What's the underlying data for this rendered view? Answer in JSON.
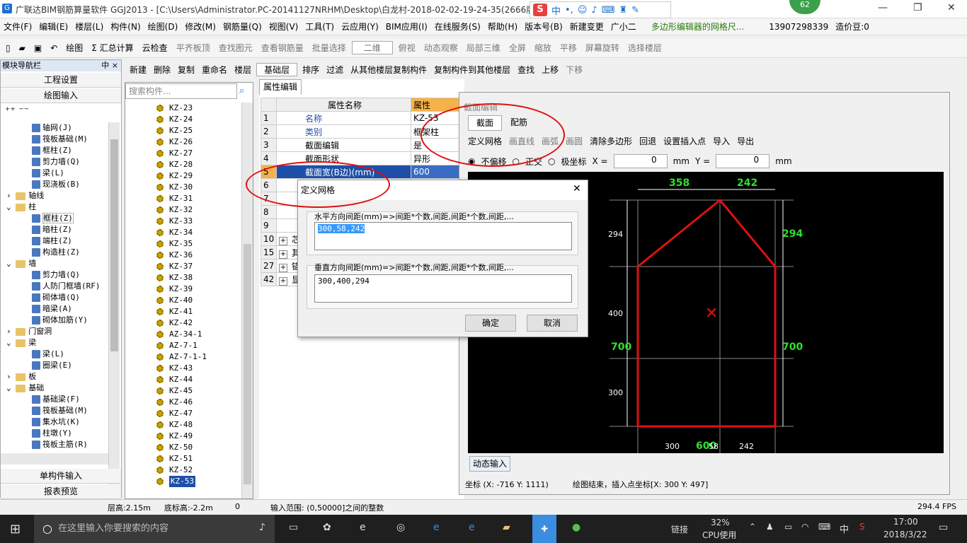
{
  "window": {
    "title": "广联达BIM钢筋算量软件 GGJ2013 - [C:\\Users\\Administrator.PC-20141127NRHM\\Desktop\\白龙村-2018-02-02-19-24-35(2666版",
    "badge": "62"
  },
  "ime": {
    "s": "S",
    "mode": "中"
  },
  "menu": [
    "文件(F)",
    "编辑(E)",
    "楼层(L)",
    "构件(N)",
    "绘图(D)",
    "修改(M)",
    "钢筋量(Q)",
    "视图(V)",
    "工具(T)",
    "云应用(Y)",
    "BIM应用(I)",
    "在线服务(S)",
    "帮助(H)",
    "版本号(B)",
    "新建变更",
    "广小二",
    "多边形编辑器的网格尺...",
    "13907298339",
    "造价豆:0"
  ],
  "toolbar": {
    "draw": "绘图",
    "sum": "Σ 汇总计算",
    "cloud": "云检查",
    "flat": "平齐板顶",
    "find": "查找图元",
    "view_rebar": "查看钢筋量",
    "batch": "批量选择",
    "view2d": "二维",
    "top": "俯视",
    "dyn": "动态观察",
    "local3d": "局部三维",
    "full": "全屏",
    "zoom": "缩放",
    "pan": "平移",
    "rotate": "屏幕旋转",
    "selfloor": "选择楼层"
  },
  "toolbar2": {
    "new": "新建",
    "delete": "删除",
    "copy": "复制",
    "rename": "重命名",
    "floor_label": "楼层",
    "floor": "基础层",
    "sort": "排序",
    "filter": "过滤",
    "copy_from": "从其他楼层复制构件",
    "copy_to": "复制构件到其他楼层",
    "find": "查找",
    "up": "上移",
    "down": "下移"
  },
  "nav": {
    "header": "模块导航栏",
    "pin": "中 ×",
    "btn1": "工程设置",
    "btn2": "绘图输入",
    "btn3": "单构件输入",
    "btn4": "报表预览"
  },
  "tree": [
    {
      "t": "轴网(J)",
      "l": 2,
      "k": "i"
    },
    {
      "t": "筏板基础(M)",
      "l": 2,
      "k": "i"
    },
    {
      "t": "框柱(Z)",
      "l": 2,
      "k": "i"
    },
    {
      "t": "剪力墙(Q)",
      "l": 2,
      "k": "i"
    },
    {
      "t": "梁(L)",
      "l": 2,
      "k": "i"
    },
    {
      "t": "现浇板(B)",
      "l": 2,
      "k": "i"
    },
    {
      "t": "轴线",
      "l": 1,
      "k": "f",
      "e": "›"
    },
    {
      "t": "柱",
      "l": 1,
      "k": "f",
      "e": "⌄"
    },
    {
      "t": "框柱(Z)",
      "l": 2,
      "k": "i"
    },
    {
      "t": "暗柱(Z)",
      "l": 2,
      "k": "i"
    },
    {
      "t": "端柱(Z)",
      "l": 2,
      "k": "i"
    },
    {
      "t": "构造柱(Z)",
      "l": 2,
      "k": "i"
    },
    {
      "t": "墙",
      "l": 1,
      "k": "f",
      "e": "⌄"
    },
    {
      "t": "剪力墙(Q)",
      "l": 2,
      "k": "i"
    },
    {
      "t": "人防门框墙(RF)",
      "l": 2,
      "k": "i"
    },
    {
      "t": "砌体墙(Q)",
      "l": 2,
      "k": "i"
    },
    {
      "t": "暗梁(A)",
      "l": 2,
      "k": "i"
    },
    {
      "t": "砌体加筋(Y)",
      "l": 2,
      "k": "i"
    },
    {
      "t": "门窗洞",
      "l": 1,
      "k": "f",
      "e": "›"
    },
    {
      "t": "梁",
      "l": 1,
      "k": "f",
      "e": "⌄"
    },
    {
      "t": "梁(L)",
      "l": 2,
      "k": "i"
    },
    {
      "t": "圈梁(E)",
      "l": 2,
      "k": "i"
    },
    {
      "t": "板",
      "l": 1,
      "k": "f",
      "e": "›"
    },
    {
      "t": "基础",
      "l": 1,
      "k": "f",
      "e": "⌄"
    },
    {
      "t": "基础梁(F)",
      "l": 2,
      "k": "i"
    },
    {
      "t": "筏板基础(M)",
      "l": 2,
      "k": "i"
    },
    {
      "t": "集水坑(K)",
      "l": 2,
      "k": "i"
    },
    {
      "t": "柱墩(Y)",
      "l": 2,
      "k": "i"
    },
    {
      "t": "筏板主筋(R)",
      "l": 2,
      "k": "i"
    }
  ],
  "search_placeholder": "搜索构件...",
  "components": [
    "KZ-23",
    "KZ-24",
    "KZ-25",
    "KZ-26",
    "KZ-27",
    "KZ-28",
    "KZ-29",
    "KZ-30",
    "KZ-31",
    "KZ-32",
    "KZ-33",
    "KZ-34",
    "KZ-35",
    "KZ-36",
    "KZ-37",
    "KZ-38",
    "KZ-39",
    "KZ-40",
    "KZ-41",
    "KZ-42",
    "AZ-34-1",
    "AZ-7-1",
    "AZ-7-1-1",
    "KZ-43",
    "KZ-44",
    "KZ-45",
    "KZ-46",
    "KZ-47",
    "KZ-48",
    "KZ-49",
    "KZ-50",
    "KZ-51",
    "KZ-52",
    "KZ-53"
  ],
  "props": {
    "tab": "属性编辑",
    "col_name": "属性名称",
    "col_val": "属性",
    "rows": [
      {
        "n": "1",
        "name": "名称",
        "val": "KZ-53"
      },
      {
        "n": "2",
        "name": "类别",
        "val": "框架柱"
      },
      {
        "n": "3",
        "name": "截面编辑",
        "val": "是"
      },
      {
        "n": "4",
        "name": "截面形状",
        "val": "异形"
      },
      {
        "n": "5",
        "name": "截面宽(B边)(mm)",
        "val": "600"
      },
      {
        "n": "6",
        "name": "截",
        "val": ""
      },
      {
        "n": "7",
        "name": "全",
        "val": ""
      },
      {
        "n": "8",
        "name": "其",
        "val": ""
      },
      {
        "n": "9",
        "name": "备",
        "val": ""
      },
      {
        "n": "10",
        "name": "芯",
        "val": "",
        "x": "+"
      },
      {
        "n": "15",
        "name": "其",
        "val": "",
        "x": "+"
      },
      {
        "n": "27",
        "name": "锚",
        "val": "",
        "x": "+"
      },
      {
        "n": "42",
        "name": "显",
        "val": "",
        "x": "+"
      }
    ]
  },
  "dialog": {
    "title": "定义网格",
    "h_label": "水平方向间距(mm)=>间距*个数,间距,间距*个数,间距,...",
    "h_value": "300,58,242",
    "v_label": "垂直方向间距(mm)=>间距*个数,间距,间距*个数,间距,...",
    "v_value": "300,400,294",
    "ok": "确定",
    "cancel": "取消"
  },
  "section": {
    "title": "截面编辑",
    "tab1": "截面",
    "tab2": "配筋",
    "define_grid": "定义网格",
    "line": "画直线",
    "arc": "画弧",
    "circle": "画圆",
    "clear": "清除多边形",
    "back": "回退",
    "set_insert": "设置插入点",
    "import": "导入",
    "export": "导出",
    "no_offset": "不偏移",
    "ortho": "正交",
    "polar": "极坐标",
    "x_label": "X =",
    "x_val": "0",
    "y_label": "Y =",
    "y_val": "0",
    "mm": "mm",
    "dyn_input": "动态输入",
    "coord": "坐标 (X: -716 Y: 1111)",
    "status": "绘图结束，插入点坐标[X: 300 Y: 497]"
  },
  "dims": {
    "top1": "358",
    "top2": "242",
    "left1": "294",
    "left2": "400",
    "left3": "300",
    "right1": "294",
    "right2": "700",
    "leftbig": "700",
    "bot1": "300",
    "bot2": "600",
    "bot3": "58",
    "bot4": "242"
  },
  "statusbar": {
    "floor_h": "层高:2.15m",
    "bottom_h": "底标高:-2.2m",
    "zero": "0",
    "range": "输入范围: (0,50000]之间的整数",
    "fps": "294.4 FPS"
  },
  "taskbar": {
    "search": "在这里输入你要搜索的内容",
    "link": "链接",
    "cpu": "32%",
    "cpu_label": "CPU使用",
    "ime": "中",
    "time": "17:00",
    "date": "2018/3/22"
  }
}
